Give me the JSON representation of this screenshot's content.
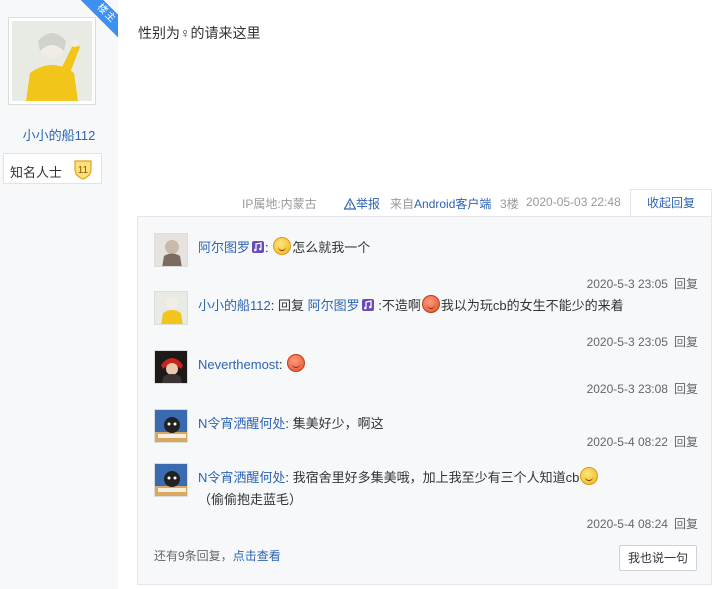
{
  "author": {
    "ribbon_label": "楼主",
    "name": "小小的船112",
    "level_title": "知名人士",
    "level_number": "11"
  },
  "post": {
    "text": "性别为♀的请来这里"
  },
  "meta": {
    "ip_location": "IP属地:内蒙古",
    "report_label": "举报",
    "client_prefix": "来自",
    "client_name": "Android客户端",
    "floor": "3楼",
    "datetime": "2020-05-03 22:48",
    "collapse_label": "收起回复"
  },
  "replies": [
    {
      "user": "阿尔图罗",
      "has_vip_icon": true,
      "text_before_emoji": "",
      "emoji": "yellow",
      "text": "怎么就我一个",
      "time": "2020-5-3 23:05",
      "reply_label": "回复"
    },
    {
      "user": "小小的船112",
      "reply_word": "回复",
      "reply_to": "阿尔图罗",
      "text_before_emoji": ":不造啊",
      "emoji": "red",
      "text": "我以为玩cb的女生不能少的来着",
      "time": "2020-5-3 23:05",
      "reply_label": "回复"
    },
    {
      "user": "Neverthemost",
      "emoji": "red",
      "text": "",
      "time": "2020-5-3 23:08",
      "reply_label": "回复"
    },
    {
      "user": "N令宵洒醒何处",
      "text": "集美好少，啊这",
      "time": "2020-5-4 08:22",
      "reply_label": "回复"
    },
    {
      "user": "N令宵洒醒何处",
      "text": "我宿舍里好多集美哦，加上我至少有三个人知道cb",
      "emoji": "yellow",
      "text_after_emoji": "（偷偷抱走蓝毛）",
      "time": "2020-5-4 08:24",
      "reply_label": "回复"
    }
  ],
  "footer": {
    "more_text": "还有9条回复，",
    "more_link": "点击查看",
    "say_button": "我也说一句"
  },
  "colors": {
    "link": "#2d64b3",
    "ribbon": "#3d8ff0",
    "panel_bg": "#f7f8fa"
  }
}
